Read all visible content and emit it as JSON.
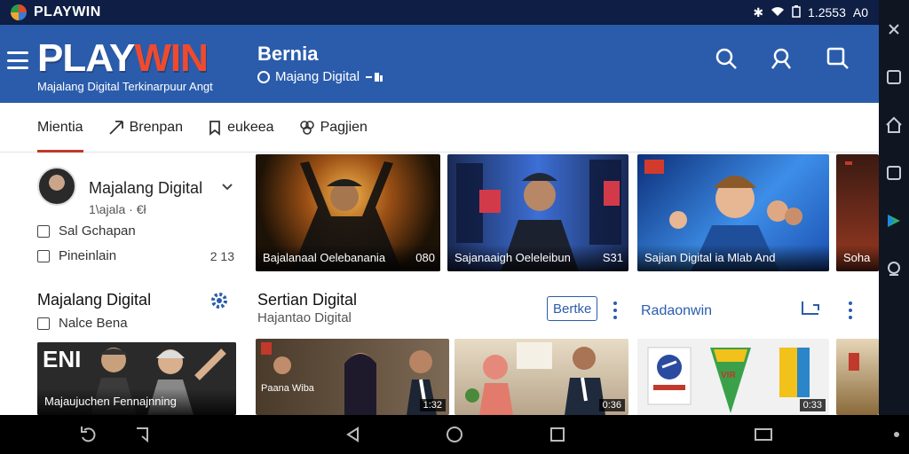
{
  "status_bar": {
    "app_name": "PLAYWIN",
    "time": "1.2553",
    "battery_text": "A0"
  },
  "header": {
    "logo_play": "PLAY",
    "logo_win": "WIN",
    "logo_tagline": "Majalang Digital Terkinarpuur Angt",
    "channel_title": "Bernia",
    "channel_subtitle": "Majang Digital"
  },
  "tabs": [
    {
      "label": "Mientia",
      "active": true
    },
    {
      "label": "Brenpan",
      "active": false
    },
    {
      "label": "eukeea",
      "active": false
    },
    {
      "label": "Pagjien",
      "active": false
    }
  ],
  "profile": {
    "name": "Majalang Digital",
    "meta": "1\\ajala · €ł",
    "rows": [
      {
        "label": "Sal Gchapan",
        "count": ""
      },
      {
        "label": "Pineinlain",
        "count": "2 13"
      }
    ]
  },
  "section_left": {
    "title": "Majalang Digital",
    "row_label": "Nalce Bena"
  },
  "section_mid": {
    "title": "Sertian Digital",
    "subtitle": "Hajantao Digital",
    "button_label": "Bertke"
  },
  "section_right": {
    "title": "Radaonwin"
  },
  "top_videos": [
    {
      "caption": "Bajalanaal Oelebanania",
      "duration": "080"
    },
    {
      "caption": "Sajanaaigh Oeleleibun",
      "duration": "S31"
    },
    {
      "caption": "Sajian Digital ia Mlab And",
      "duration": ""
    },
    {
      "caption": "Soha",
      "duration": ""
    }
  ],
  "bottom_videos": [
    {
      "overlay": "ENI",
      "caption": "Majaujuchen Fennajnning",
      "duration": ""
    },
    {
      "overlay": "Paana Wiba",
      "caption": "",
      "duration": "1:32"
    },
    {
      "overlay": "",
      "caption": "",
      "duration": "0:36"
    },
    {
      "overlay": "VIR",
      "caption": "",
      "duration": "0:33"
    }
  ],
  "colors": {
    "header_blue": "#2b5cac",
    "accent_red": "#c0392b",
    "logo_win": "#f04a2e"
  }
}
